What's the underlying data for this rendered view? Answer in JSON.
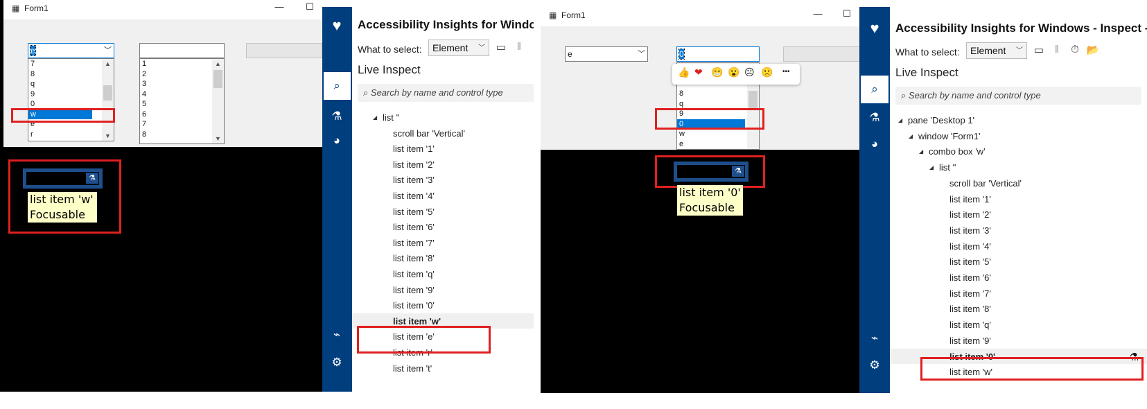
{
  "left": {
    "form": {
      "title": "Form1",
      "minimize": "—",
      "maximize": "☐",
      "combo_value": "e",
      "combo_items": [
        "7",
        "8",
        "q",
        "9",
        "0",
        "w",
        "e",
        "r"
      ],
      "combo_highlighted": "w",
      "list_items": [
        "1",
        "2",
        "3",
        "4",
        "5",
        "6",
        "7",
        "8"
      ]
    },
    "tooltip": {
      "line1": "list item 'w'",
      "line2": "Focusable"
    },
    "inspect_flask": "⚗"
  },
  "right": {
    "form": {
      "title": "Form1",
      "minimize": "—",
      "maximize": "☐",
      "close": "✕",
      "combo_value": "e",
      "list_value": "0",
      "list_items": [
        "8",
        "q",
        "9",
        "0",
        "w",
        "e"
      ],
      "list_highlighted": "0"
    },
    "emoji": [
      "👍",
      "❤",
      "😁",
      "😮",
      "☹",
      "🙁"
    ],
    "emoji_more": "•••",
    "tooltip": {
      "line1": "list item '0'",
      "line2": "Focusable"
    },
    "inspect_flask": "⚗"
  },
  "ai_left": {
    "title": "Accessibility Insights for Windov",
    "what_to_select_label": "What to select:",
    "what_to_select_value": "Element",
    "live_inspect": "Live Inspect",
    "search_placeholder": "Search by name and control type",
    "tree": [
      {
        "text": "list ''",
        "indent": 0,
        "tri": true
      },
      {
        "text": "scroll bar 'Vertical'",
        "indent": 1
      },
      {
        "text": "list item '1'",
        "indent": 1
      },
      {
        "text": "list item '2'",
        "indent": 1
      },
      {
        "text": "list item '3'",
        "indent": 1
      },
      {
        "text": "list item '4'",
        "indent": 1
      },
      {
        "text": "list item '5'",
        "indent": 1
      },
      {
        "text": "list item '6'",
        "indent": 1
      },
      {
        "text": "list item '7'",
        "indent": 1
      },
      {
        "text": "list item '8'",
        "indent": 1
      },
      {
        "text": "list item 'q'",
        "indent": 1
      },
      {
        "text": "list item '9'",
        "indent": 1
      },
      {
        "text": "list item '0'",
        "indent": 1
      },
      {
        "text": "list item 'w'",
        "indent": 1,
        "selected": true
      },
      {
        "text": "list item 'e'",
        "indent": 1
      },
      {
        "text": "list item 'r'",
        "indent": 1
      },
      {
        "text": "list item 't'",
        "indent": 1
      }
    ]
  },
  "ai_right": {
    "title": "Accessibility Insights for Windows - Inspect -",
    "what_to_select_label": "What to select:",
    "what_to_select_value": "Element",
    "live_inspect": "Live Inspect",
    "search_placeholder": "Search by name and control type",
    "tree": [
      {
        "text": "pane 'Desktop 1'",
        "indent": 0,
        "tri": true
      },
      {
        "text": "window 'Form1'",
        "indent": 1,
        "tri": true
      },
      {
        "text": "combo box 'w'",
        "indent": 2,
        "tri": true
      },
      {
        "text": "list ''",
        "indent": 3,
        "tri": true
      },
      {
        "text": "scroll bar 'Vertical'",
        "indent": 4
      },
      {
        "text": "list item '1'",
        "indent": 4
      },
      {
        "text": "list item '2'",
        "indent": 4
      },
      {
        "text": "list item '3'",
        "indent": 4
      },
      {
        "text": "list item '4'",
        "indent": 4
      },
      {
        "text": "list item '5'",
        "indent": 4
      },
      {
        "text": "list item '6'",
        "indent": 4
      },
      {
        "text": "list item '7'",
        "indent": 4
      },
      {
        "text": "list item '8'",
        "indent": 4
      },
      {
        "text": "list item 'q'",
        "indent": 4
      },
      {
        "text": "list item '9'",
        "indent": 4
      },
      {
        "text": "list item '0'",
        "indent": 4,
        "selected": true
      },
      {
        "text": "list item 'w'",
        "indent": 4
      }
    ],
    "row_flask": "⚗"
  },
  "rail_icons": {
    "logo": "♥",
    "inspect": "⌕",
    "test": "⚗",
    "color": "◕",
    "connect": "⌁",
    "settings": "⚙"
  },
  "toolbar": {
    "window": "▭",
    "pause": "‖",
    "timer": "⏱",
    "folder": "📂",
    "search": "⌕"
  },
  "colors": {
    "accent": "#0078d7",
    "rail": "#003e7e",
    "highlight_box": "#e02020",
    "tooltip": "#ffffc8"
  }
}
